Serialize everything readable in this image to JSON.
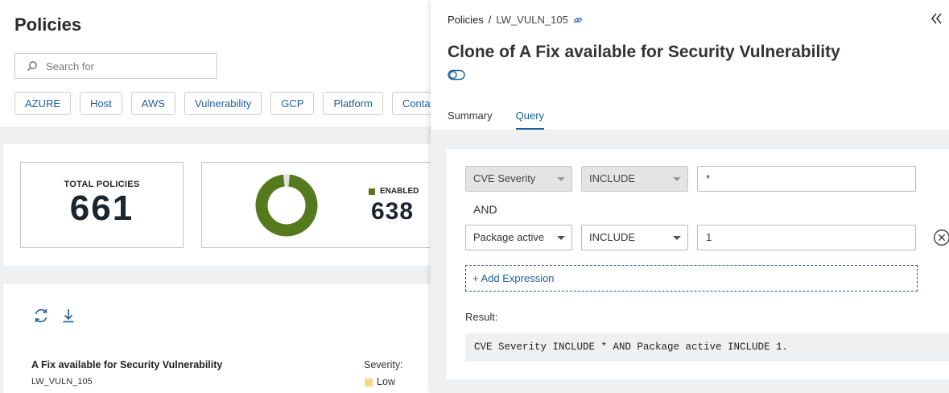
{
  "left": {
    "page_title": "Policies",
    "search": {
      "placeholder": "Search for",
      "value": ""
    },
    "tags": [
      "AZURE",
      "Host",
      "AWS",
      "Vulnerability",
      "GCP",
      "Platform",
      "Conta"
    ],
    "stats": {
      "total_label": "TOTAL POLICIES",
      "total_value": "661",
      "enabled_label": "ENABLED",
      "enabled_value": "638",
      "enabled_fraction": 0.965,
      "enabled_color": "#557a1e"
    },
    "policy": {
      "name": "A Fix available for Security Vulnerability",
      "id": "LW_VULN_105",
      "severity_label": "Severity:",
      "severity_value": "Low",
      "severity_color": "#f3d98a"
    }
  },
  "drawer": {
    "breadcrumb": {
      "root": "Policies",
      "separator": "/",
      "current": "LW_VULN_105"
    },
    "title": "Clone of A Fix available for Security Vulnerability",
    "tabs": [
      {
        "label": "Summary",
        "active": false
      },
      {
        "label": "Query",
        "active": true
      }
    ],
    "query": {
      "rows": [
        {
          "field": "CVE Severity",
          "operator": "INCLUDE",
          "value": "*",
          "disabled": true
        },
        {
          "field": "Package active",
          "operator": "INCLUDE",
          "value": "1",
          "disabled": false
        }
      ],
      "connector": "AND",
      "add_expression_label": "+ Add Expression",
      "result_label": "Result:",
      "result_text": "CVE Severity INCLUDE * AND Package active INCLUDE 1."
    }
  },
  "colors": {
    "accent": "#1d5f9e",
    "enabled": "#557a1e"
  }
}
